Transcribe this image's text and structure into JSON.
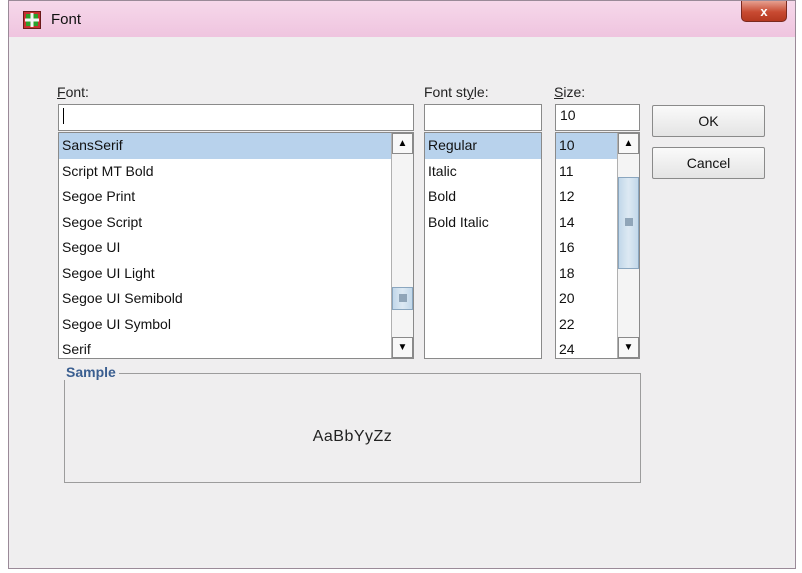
{
  "window": {
    "title": "Font",
    "close_label": "x"
  },
  "font": {
    "label_prefix": "",
    "label_mnemonic": "F",
    "label_rest": "ont:",
    "input_value": "",
    "items": [
      "SansSerif",
      "Script MT Bold",
      "Segoe Print",
      "Segoe Script",
      "Segoe UI",
      "Segoe UI Light",
      "Segoe UI Semibold",
      "Segoe UI Symbol",
      "Serif"
    ],
    "selected": "SansSerif"
  },
  "style": {
    "label_prefix": "Font st",
    "label_mnemonic": "y",
    "label_rest": "le:",
    "input_value": "",
    "items": [
      "Regular",
      "Italic",
      "Bold",
      "Bold Italic"
    ],
    "selected": "Regular"
  },
  "size": {
    "label_prefix": "",
    "label_mnemonic": "S",
    "label_rest": "ize:",
    "input_value": "10",
    "items": [
      "10",
      "11",
      "12",
      "14",
      "16",
      "18",
      "20",
      "22",
      "24"
    ],
    "selected": "10"
  },
  "buttons": {
    "ok": "OK",
    "cancel": "Cancel"
  },
  "sample": {
    "legend": "Sample",
    "text": "AaBbYyZz"
  },
  "colors": {
    "selection": "#b8d2ec",
    "title_bar": "#efc4df",
    "close_button": "#c84a32",
    "sample_legend": "#3a5e90"
  },
  "icons": {
    "app": "font-app-icon",
    "scroll_up": "arrow-up-icon",
    "scroll_down": "arrow-down-icon"
  }
}
